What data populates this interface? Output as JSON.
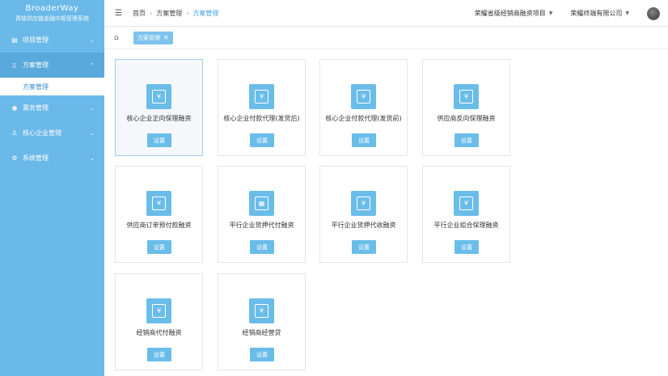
{
  "brand": {
    "name": "BroaderWay",
    "subtitle": "青桔供应链金融中枢管理系统"
  },
  "sidebar": {
    "items": [
      {
        "label": "项目管理",
        "icon": "list-icon"
      },
      {
        "label": "方案管理",
        "icon": "document-icon",
        "active": true,
        "children": [
          {
            "label": "方案管理"
          }
        ]
      },
      {
        "label": "票务管理",
        "icon": "ticket-icon"
      },
      {
        "label": "核心企业管理",
        "icon": "users-icon"
      },
      {
        "label": "系统管理",
        "icon": "gear-icon"
      }
    ]
  },
  "topbar": {
    "breadcrumb": [
      "首页",
      "方案管理",
      "方案管理"
    ],
    "project_select": "荣耀省级经销商融资项目",
    "company_select": "荣耀终端有限公司"
  },
  "tags": [
    {
      "label": "方案管理"
    }
  ],
  "cards": [
    {
      "title": "核心企业正向保理融资",
      "button": "设置",
      "icon": "¥"
    },
    {
      "title": "核心企业付款代理(发货后)",
      "button": "设置",
      "icon": "¥"
    },
    {
      "title": "核心企业付款代理(发货前)",
      "button": "设置",
      "icon": "¥"
    },
    {
      "title": "供应商反向保理融资",
      "button": "设置",
      "icon": "¥"
    },
    {
      "title": "供应商订单预付款融资",
      "button": "设置",
      "icon": "¥"
    },
    {
      "title": "平行企业货押代付融资",
      "button": "设置",
      "icon": "▦"
    },
    {
      "title": "平行企业货押代收融资",
      "button": "设置",
      "icon": "¥"
    },
    {
      "title": "平行企业组合保理融资",
      "button": "设置",
      "icon": "¥"
    },
    {
      "title": "经销商代付融资",
      "button": "设置",
      "icon": "¥"
    },
    {
      "title": "经销商经营贷",
      "button": "设置",
      "icon": "¥"
    }
  ],
  "colors": {
    "sidebar": "#6bb9e8",
    "accent": "#6bbde9",
    "active_text": "#3a8fd0"
  }
}
